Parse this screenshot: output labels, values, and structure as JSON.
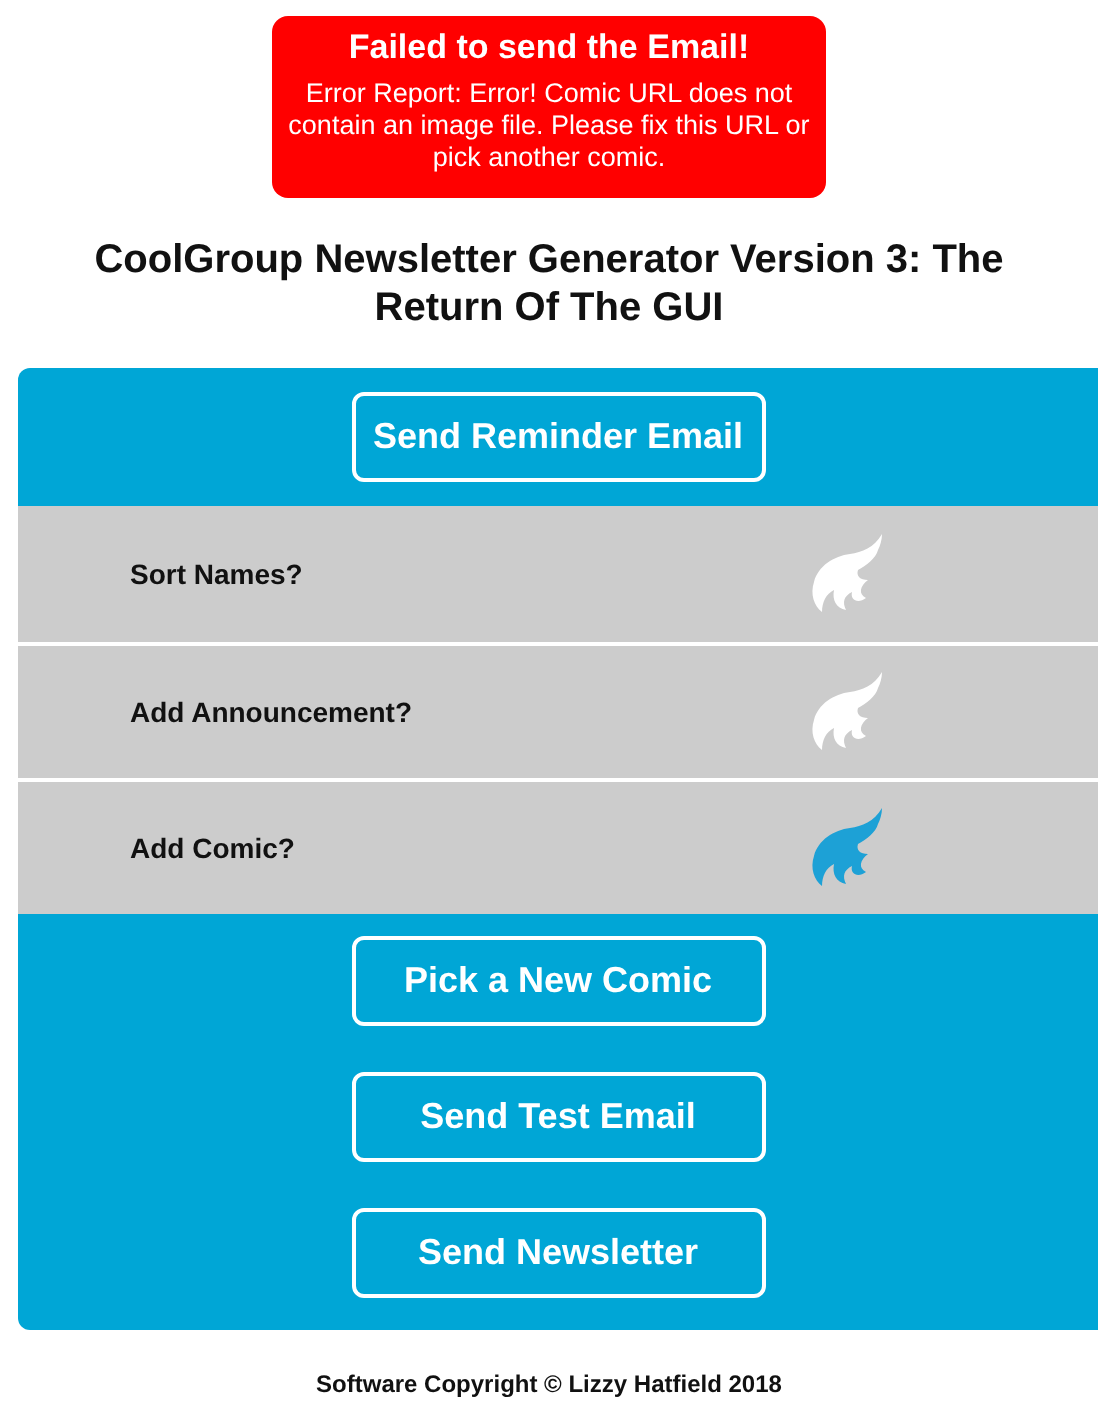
{
  "error": {
    "title": "Failed to send the Email!",
    "message": "Error Report: Error! Comic URL does not contain an image file. Please fix this URL or pick another comic."
  },
  "heading": "CoolGroup Newsletter Generator Version 3: The Return Of The GUI",
  "top_button": "Send Reminder Email",
  "options": [
    {
      "label": "Sort Names?",
      "on": false
    },
    {
      "label": "Add Announcement?",
      "on": false
    },
    {
      "label": "Add Comic?",
      "on": true
    }
  ],
  "bottom_buttons": [
    "Pick a New Comic",
    "Send Test Email",
    "Send Newsletter"
  ],
  "footer": "Software Copyright © Lizzy Hatfield 2018"
}
